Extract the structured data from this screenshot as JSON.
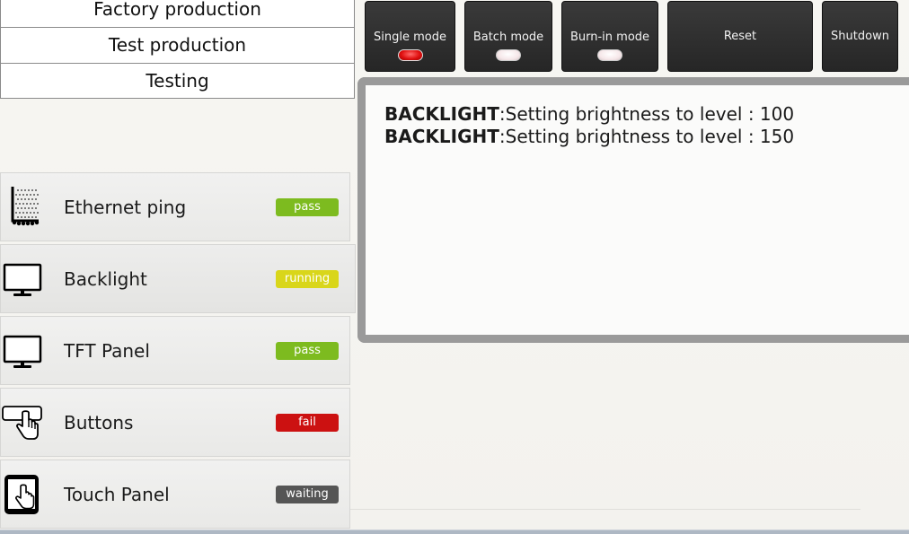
{
  "menu": {
    "items": [
      {
        "label": "Factory production"
      },
      {
        "label": "Test production"
      },
      {
        "label": "Testing"
      }
    ]
  },
  "toolbar": {
    "single_mode_label": "Single mode",
    "single_mode_active": true,
    "batch_mode_label": "Batch mode",
    "batch_mode_active": false,
    "burnin_mode_label": "Burn-in mode",
    "burnin_mode_active": false,
    "reset_label": "Reset",
    "shutdown_label": "Shutdown"
  },
  "log": {
    "lines": [
      {
        "tag": "BACKLIGHT",
        "text": ":Setting brightness to level : 100"
      },
      {
        "tag": "BACKLIGHT",
        "text": ":Setting brightness to level : 150"
      }
    ]
  },
  "tests": [
    {
      "name": "Ethernet ping",
      "icon": "ethernet-graph-icon",
      "status": "pass",
      "status_color": "#7dbb1f"
    },
    {
      "name": "Backlight",
      "icon": "monitor-icon",
      "status": "running",
      "status_color": "#d9d61a"
    },
    {
      "name": "TFT Panel",
      "icon": "monitor-icon",
      "status": "pass",
      "status_color": "#7dbb1f"
    },
    {
      "name": "Buttons",
      "icon": "button-press-icon",
      "status": "fail",
      "status_color": "#cc1111"
    },
    {
      "name": "Touch Panel",
      "icon": "touch-panel-icon",
      "status": "waiting",
      "status_color": "#555555"
    }
  ],
  "colors": {
    "pass": "#7dbb1f",
    "running": "#d9d61a",
    "fail": "#cc1111",
    "waiting": "#555555",
    "toolbar_button": "#2e2e2e",
    "log_border": "#9a9a9a",
    "led_on": "#e01010"
  }
}
